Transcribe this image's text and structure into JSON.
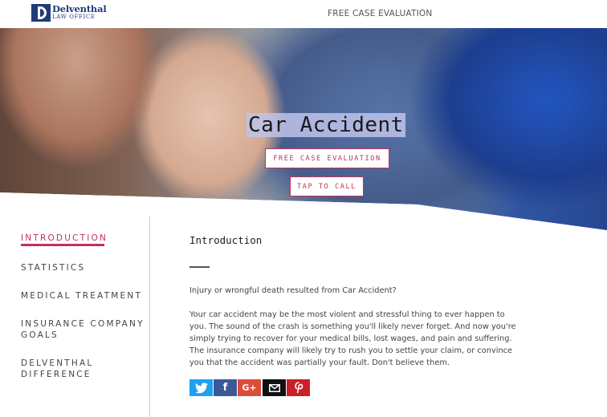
{
  "header": {
    "logo_name": "Delventhal",
    "logo_sub": "LAW OFFICE",
    "nav_link": "FREE CASE EVALUATION"
  },
  "hero": {
    "title": "Car Accident",
    "eval_button": "FREE CASE EVALUATION",
    "call_button": "TAP TO CALL"
  },
  "sidebar": {
    "items": [
      {
        "label": "INTRODUCTION",
        "active": true
      },
      {
        "label": "STATISTICS"
      },
      {
        "label": "MEDICAL TREATMENT"
      },
      {
        "label_line1": "INSURANCE COMPANY",
        "label_line2": "GOALS"
      },
      {
        "label_line1": "DELVENTHAL",
        "label_line2": "DIFFERENCE"
      }
    ]
  },
  "content": {
    "title": "Introduction",
    "paragraph1": "Injury or wrongful death resulted from Car Accident?",
    "paragraph2": "Your car accident may be the most violent and stressful thing to ever happen to you. The sound of the crash is something you'll likely never forget. And now you're simply trying to recover for your medical bills, lost wages, and pain and suffering. The insurance company will likely try to rush you to settle your claim, or convince you that the accident was partially your fault. Don't believe them."
  },
  "share": {
    "icons": [
      "twitter-icon",
      "facebook-icon",
      "google-plus-icon",
      "email-icon",
      "pinterest-icon"
    ],
    "google_plus_text": "G+",
    "facebook_text": "f"
  },
  "colors": {
    "accent": "#c0325a",
    "brand": "#1f3a7a"
  }
}
